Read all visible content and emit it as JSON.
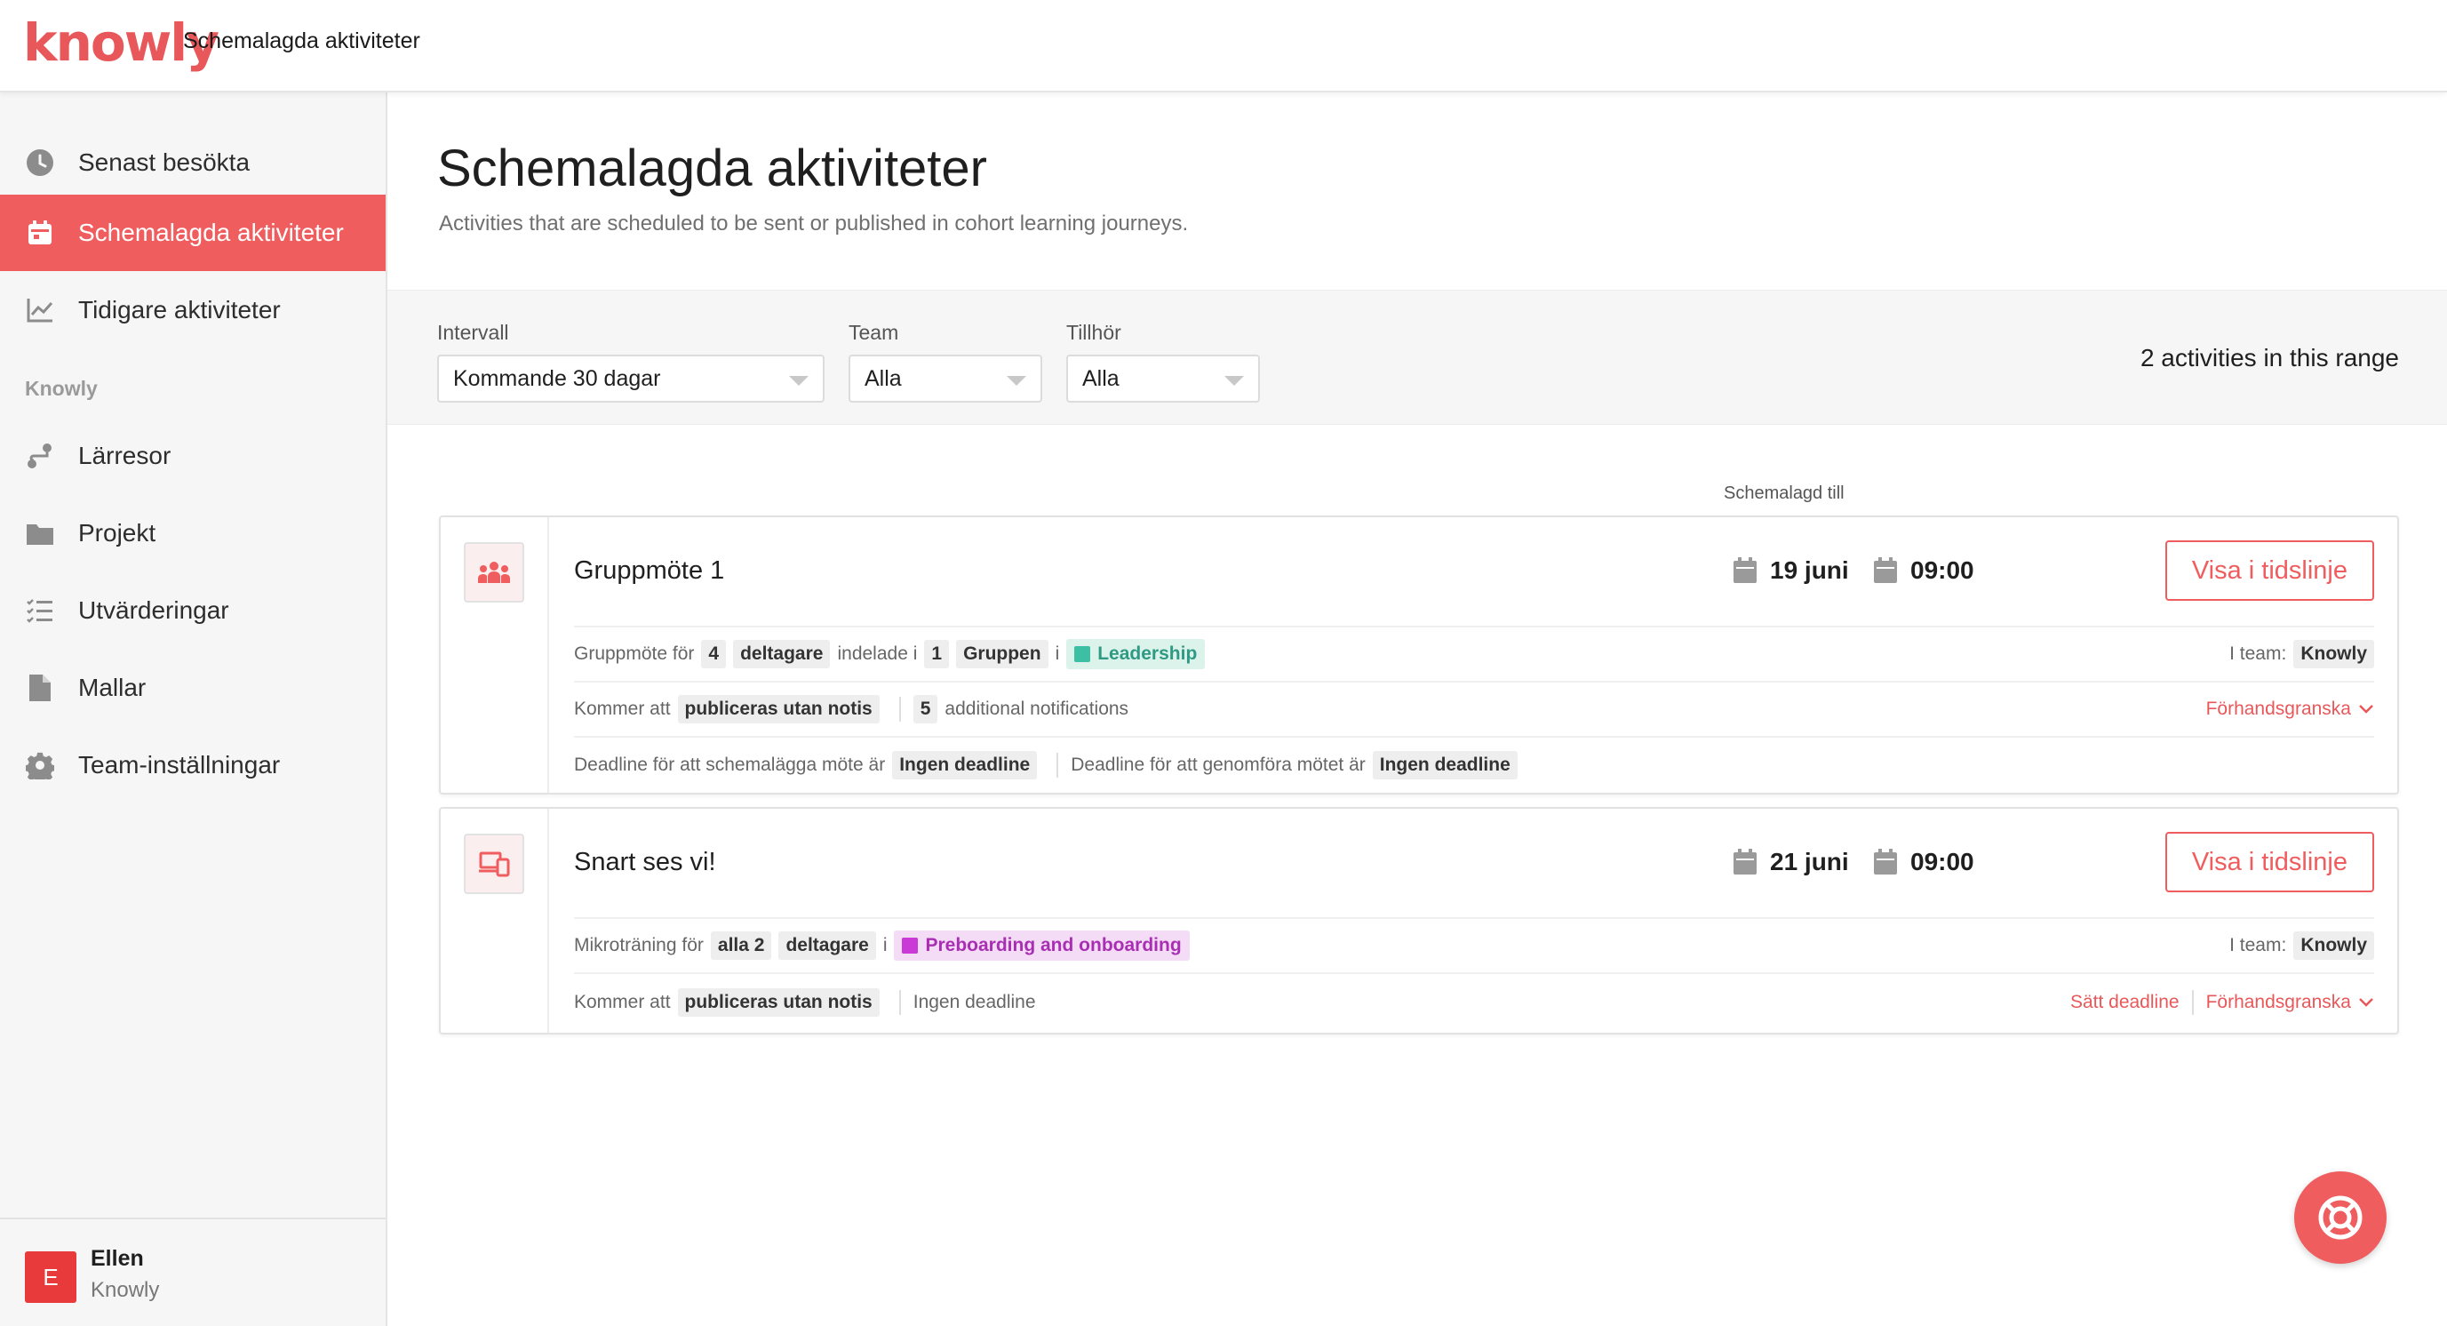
{
  "app": {
    "logo_text": "knowly",
    "page_title": "Schemalagda aktiviteter",
    "accent_color": "#ef5d5e"
  },
  "sidebar": {
    "items": [
      {
        "label": "Senast besökta",
        "icon": "clock-icon"
      },
      {
        "label": "Schemalagda aktiviteter",
        "icon": "calendar-icon",
        "active": true
      },
      {
        "label": "Tidigare aktiviteter",
        "icon": "chart-icon"
      }
    ],
    "section_label": "Knowly",
    "section_items": [
      {
        "label": "Lärresor",
        "icon": "route-icon"
      },
      {
        "label": "Projekt",
        "icon": "folder-icon"
      },
      {
        "label": "Utvärderingar",
        "icon": "checklist-icon"
      },
      {
        "label": "Mallar",
        "icon": "document-icon"
      },
      {
        "label": "Team-inställningar",
        "icon": "gear-icon"
      }
    ],
    "user": {
      "initial": "E",
      "name": "Ellen",
      "team": "Knowly"
    }
  },
  "main": {
    "title": "Schemalagda aktiviteter",
    "subtitle": "Activities that are scheduled to be sent or published in cohort learning journeys.",
    "filters": {
      "interval_label": "Intervall",
      "interval_value": "Kommande 30 dagar",
      "team_label": "Team",
      "team_value": "Alla",
      "belongs_label": "Tillhör",
      "belongs_value": "Alla",
      "count_text": "2 activities in this range"
    },
    "column_header": "Schemalagd till"
  },
  "activities": [
    {
      "title": "Gruppmöte 1",
      "icon": "group-icon",
      "date": "19 juni",
      "time": "09:00",
      "button": "Visa i tidslinje",
      "row1": {
        "t1": "Gruppmöte för",
        "participants_count": "4",
        "participants_word": "deltagare",
        "t2": "indelade i",
        "groups_count": "1",
        "groups_word": "Gruppen",
        "t3": "i",
        "tag": "Leadership",
        "tag_color": "#3cbfa3",
        "tag_bg": "#dcf3ec",
        "team_label": "I team:",
        "team_value": "Knowly"
      },
      "row2": {
        "t1": "Kommer att",
        "publish_mode": "publiceras utan notis",
        "notif_count": "5",
        "notif_text": "additional notifications",
        "preview": "Förhandsgranska"
      },
      "row3": {
        "t1": "Deadline för att schemalägga möte är",
        "v1": "Ingen deadline",
        "t2": "Deadline för att genomföra mötet är",
        "v2": "Ingen deadline"
      }
    },
    {
      "title": "Snart ses vi!",
      "icon": "devices-icon",
      "date": "21 juni",
      "time": "09:00",
      "button": "Visa i tidslinje",
      "row1": {
        "t1": "Mikroträning för",
        "participants_count": "alla 2",
        "participants_word": "deltagare",
        "t3": "i",
        "tag": "Preboarding and onboarding",
        "tag_color": "#c93ad6",
        "tag_bg": "#f5dcf6",
        "team_label": "I team:",
        "team_value": "Knowly"
      },
      "row2": {
        "t1": "Kommer att",
        "publish_mode": "publiceras utan notis",
        "deadline_text": "Ingen deadline",
        "set_deadline": "Sätt deadline",
        "preview": "Förhandsgranska"
      }
    }
  ],
  "help_button": {
    "icon": "lifebuoy-icon"
  }
}
